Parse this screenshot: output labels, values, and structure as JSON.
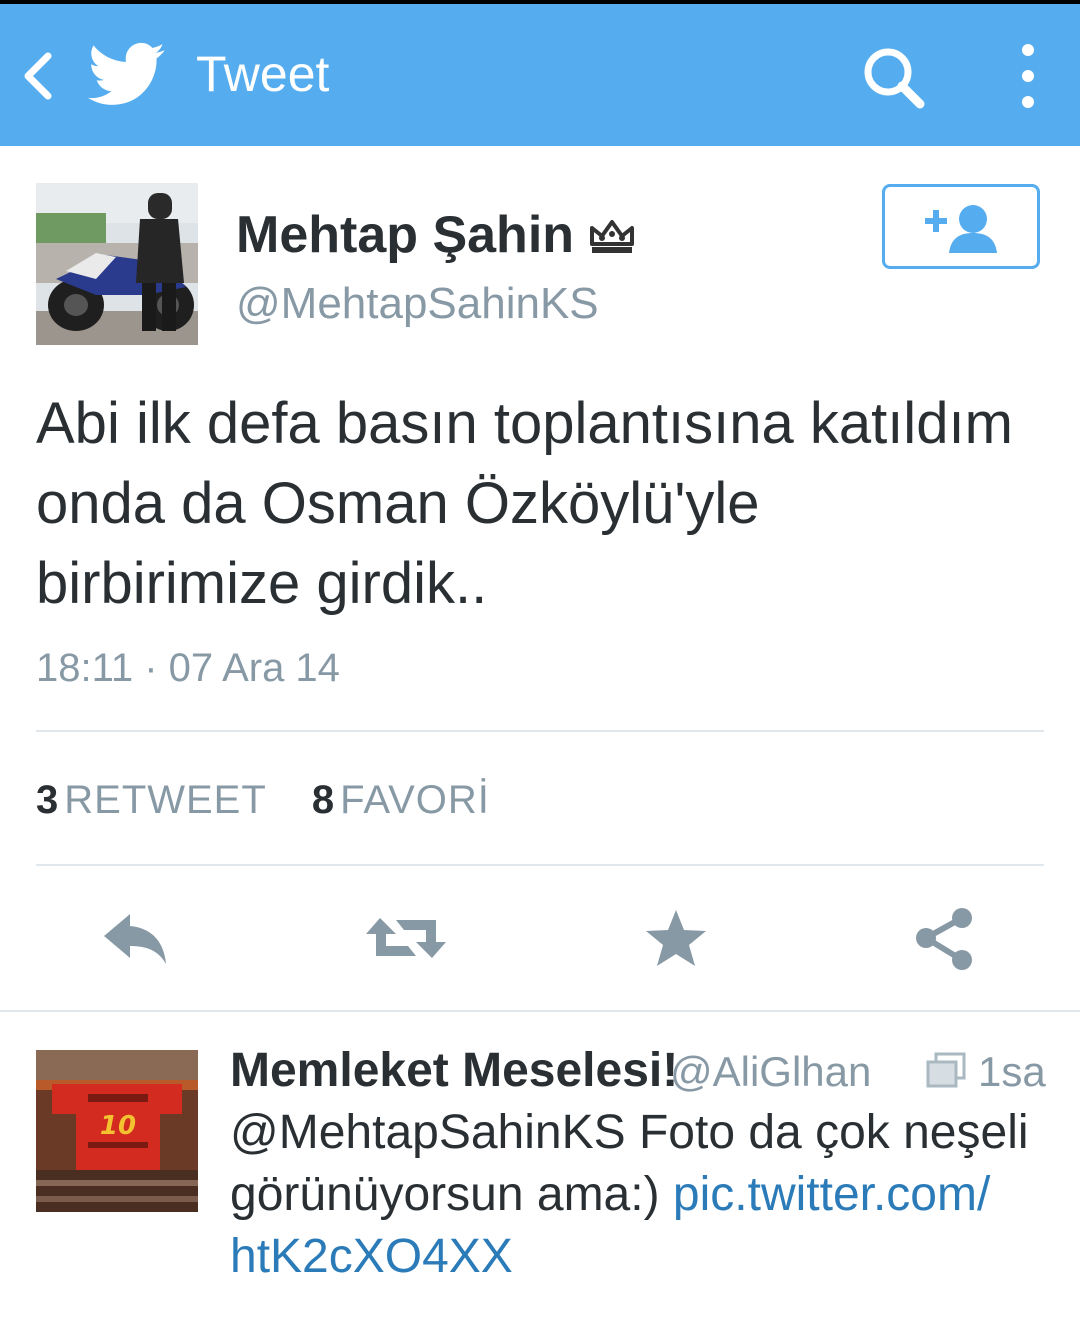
{
  "appbar": {
    "title": "Tweet",
    "color": "#55acee",
    "icons": [
      "back-arrow-icon",
      "twitter-bird-icon",
      "search-icon",
      "overflow-menu-icon"
    ]
  },
  "tweet": {
    "author_name": "Mehtap Şahin",
    "author_handle": "@MehtapSahinKS",
    "text_lines": [
      "Abi ilk defa basın toplantısına katıldım",
      "onda da Osman Özköylü'yle",
      "birbirimize girdik.."
    ],
    "timestamp": "18:11 · 07 Ara 14",
    "retweet_count": "3",
    "retweet_label": "RETWEET",
    "favorite_count": "8",
    "favorite_label": "FAVORİ",
    "actions": [
      "reply-icon",
      "retweet-icon",
      "favorite-star-icon",
      "share-icon"
    ]
  },
  "reply": {
    "author_name": "Memleket Meselesi!",
    "author_handle": "@AliGlhan",
    "time": "1sa",
    "text": "@MehtapSahinKS Foto da çok neşeli görünüyorsun ama:)",
    "link_line1": "pic.twitter.com/",
    "link_line2": "htK2cXO4XX",
    "link_color": "#2b7bb9"
  }
}
